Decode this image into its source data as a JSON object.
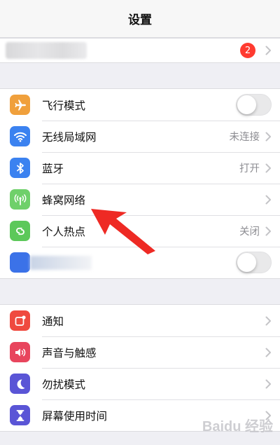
{
  "header": {
    "title": "设置"
  },
  "profile": {
    "badge": "2"
  },
  "group1": [
    {
      "id": "airplane",
      "label": "飞行模式",
      "icon": "airplane-icon",
      "color": "#f0a03c",
      "control": "toggle",
      "on": false
    },
    {
      "id": "wifi",
      "label": "无线局域网",
      "icon": "wifi-icon",
      "color": "#3b82f0",
      "value": "未连接",
      "control": "chevron"
    },
    {
      "id": "bluetooth",
      "label": "蓝牙",
      "icon": "bluetooth-icon",
      "color": "#3b82f0",
      "value": "打开",
      "control": "chevron"
    },
    {
      "id": "cellular",
      "label": "蜂窝网络",
      "icon": "antenna-icon",
      "color": "#6fd06a",
      "control": "chevron"
    },
    {
      "id": "hotspot",
      "label": "个人热点",
      "icon": "hotspot-icon",
      "color": "#5cc85a",
      "value": "关闭",
      "control": "chevron"
    },
    {
      "id": "vpn",
      "label": "",
      "icon": "vpn-icon",
      "color": "#3b72e8",
      "control": "toggle",
      "on": false
    }
  ],
  "group2": [
    {
      "id": "notifications",
      "label": "通知",
      "icon": "notification-icon",
      "color": "#ef4a3f"
    },
    {
      "id": "sounds",
      "label": "声音与触感",
      "icon": "speaker-icon",
      "color": "#e8455d"
    },
    {
      "id": "dnd",
      "label": "勿扰模式",
      "icon": "moon-icon",
      "color": "#5a55d6"
    },
    {
      "id": "screentime",
      "label": "屏幕使用时间",
      "icon": "hourglass-icon",
      "color": "#5a55d6"
    }
  ],
  "watermark": "Baidu 经验"
}
